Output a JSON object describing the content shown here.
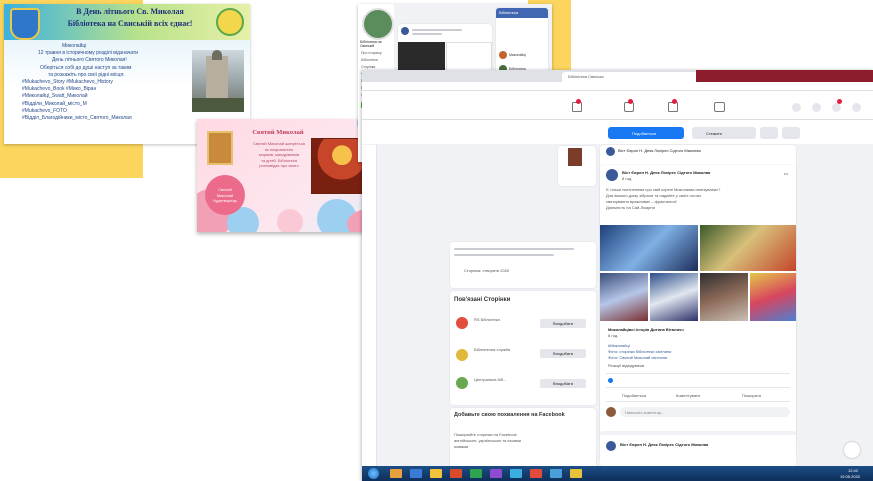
{
  "slide1": {
    "title_line1": "В День літнього Св. Миколая",
    "title_line2": "Бібліотека на Свиській всіх єднає!",
    "body_lines": [
      "Миколайці",
      "12 травня в історичному розділі відзначати",
      "День літнього Святого Миколая!",
      "Оберіться собі до душі наступ за таким",
      "та розкажіть про свої рідні місця:",
      "#Mukachevo_Story #Mukachevo_History",
      "#Mukachevo_Book #Мико_Віран",
      "#Миколайці_Swatt_Миколай",
      "#Відділи_Миколай_місто_М",
      "#Mukachevo_FOTO",
      "#Відділ_Благодійники_місто_Святого_Миколая"
    ]
  },
  "slide2": {
    "title": "Святий Миколай",
    "text_lines": [
      "Святий Миколай шанується",
      "як покровитель",
      "моряків, мандрівників",
      "та дітей. Бібліотека",
      "розповідає про свято"
    ],
    "badge_lines": [
      "Святий",
      "Миколай",
      "Чудотворець"
    ]
  },
  "browser": {
    "tabs": [
      "Бібліотека Свиська",
      "Facebook"
    ],
    "left_button": "Подобається",
    "like_button": "Стежити",
    "post_author": "Віст Європ Н. Деяк Лохірес Сідтого Миколая",
    "post_time": "8 год.",
    "post_text": [
      "Є тільки натхненням про свій корені Миколаєва святкуваних?",
      "Для вашого дому зібрали та надайте у своїх гостях",
      "святкування вражливих – фрактальні!",
      "Діяльність на Сай-Лікарни"
    ],
    "post_sub_author": "Миколайцівсі Історія Дитина Віталичч",
    "post_sub_time": "8 год.",
    "post_links": [
      "#Миколайці",
      "Фото: сторінки бібліотеки світлини",
      "Фото: Святий Миколай світлини"
    ],
    "post_footer": "Реакції відвідувачів",
    "actions": [
      "Подобається",
      "Коментувати",
      "Поширити"
    ],
    "comment_placeholder": "Напишіть коментар...",
    "second_post_author": "Віст Європ Н. Деяк Лохірес Сідтого Миколая",
    "sidebar_item_top": "Сторінка: створити 2020",
    "related_title": "Пов'язані Сторінки",
    "related": [
      {
        "name": "RS Бібліотека",
        "btn": "Вподобати"
      },
      {
        "name": "Бібліотечна служба",
        "btn": "Вподобати"
      },
      {
        "name": "Центральна біб...",
        "btn": "Вподобати"
      }
    ],
    "add_lang_title": "Добавьте свою похвалення на Facebook",
    "add_lang_lines": [
      "Поширюйте сторінки на Facebook",
      "англійською, українською та іншими",
      "мовами"
    ],
    "taskbar_time": "12:42",
    "taskbar_date": "19.05.2020"
  },
  "fb1": {
    "page_name": "Бібліотека на Свиській",
    "about_lines": [
      "Про сторінку",
      "Бібліотека",
      "Сторінка",
      "Фото",
      "Події",
      "Відео",
      "Спільнота"
    ],
    "widget_title": "Бібліотека",
    "right_items": [
      "Миколайці",
      "Бібліотека",
      "Історія",
      "Сторінки"
    ]
  }
}
